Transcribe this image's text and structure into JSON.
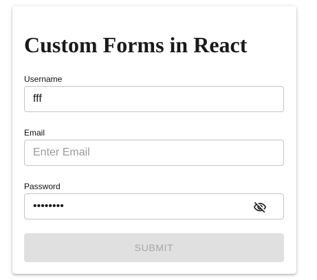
{
  "form": {
    "title": "Custom Forms in React",
    "username": {
      "label": "Username",
      "value": "fff",
      "placeholder": ""
    },
    "email": {
      "label": "Email",
      "value": "",
      "placeholder": "Enter Email"
    },
    "password": {
      "label": "Password",
      "value": "abcdefgh",
      "toggle_icon": "eye-off-icon"
    },
    "submit_label": "SUBMIT",
    "colors": {
      "submit_bg": "#e0e0e0",
      "submit_text": "#a6a6a6",
      "field_border": "#c4c4c4"
    }
  }
}
